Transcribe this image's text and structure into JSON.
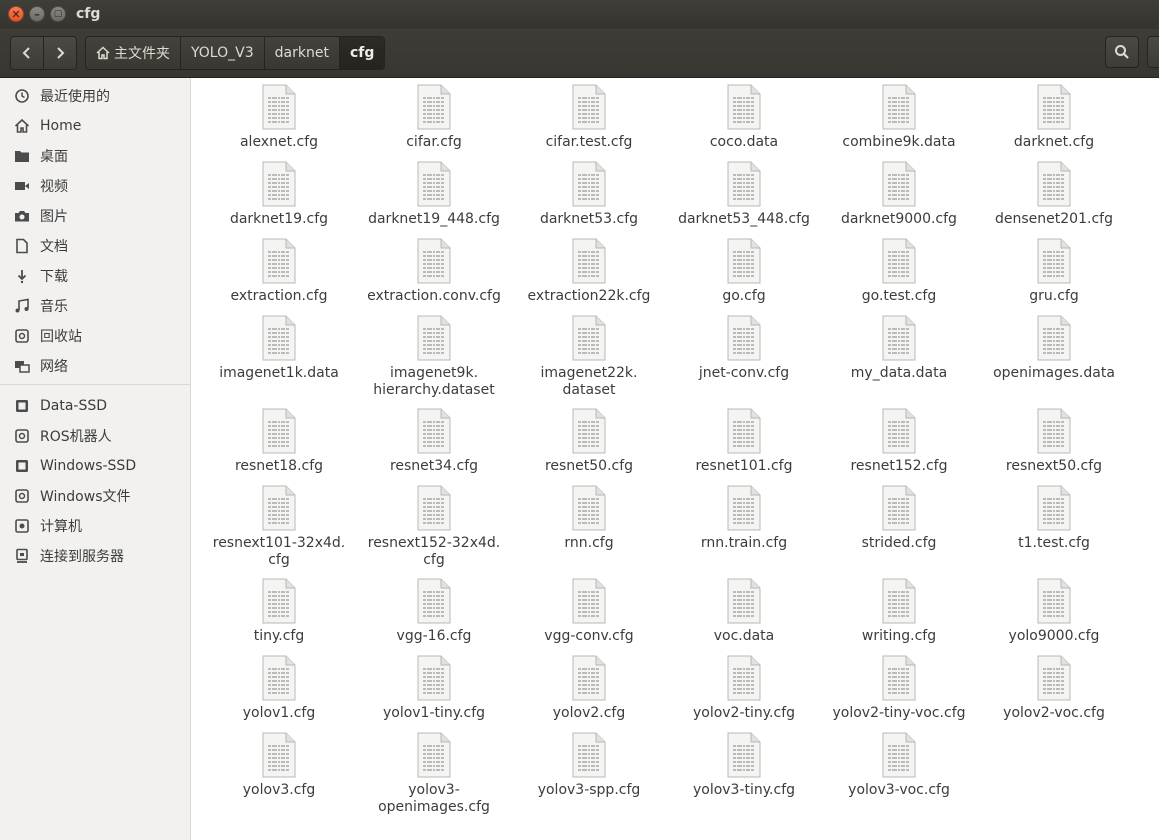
{
  "window": {
    "title": "cfg"
  },
  "toolbar": {
    "back_icon": "chevron-left-icon",
    "forward_icon": "chevron-right-icon",
    "breadcrumb": [
      "主文件夹",
      "YOLO_V3",
      "darknet",
      "cfg"
    ],
    "search_icon": "search-icon"
  },
  "sidebar": {
    "places": [
      {
        "label": "最近使用的",
        "icon": "clock-icon"
      },
      {
        "label": "Home",
        "icon": "home-icon"
      },
      {
        "label": "桌面",
        "icon": "folder-icon"
      },
      {
        "label": "视频",
        "icon": "video-icon"
      },
      {
        "label": "图片",
        "icon": "camera-icon"
      },
      {
        "label": "文档",
        "icon": "document-icon"
      },
      {
        "label": "下载",
        "icon": "download-icon"
      },
      {
        "label": "音乐",
        "icon": "music-icon"
      },
      {
        "label": "回收站",
        "icon": "trash-icon"
      },
      {
        "label": "网络",
        "icon": "network-icon"
      }
    ],
    "devices": [
      {
        "label": "Data-SSD",
        "icon": "drive-icon"
      },
      {
        "label": "ROS机器人",
        "icon": "disc-icon"
      },
      {
        "label": "Windows-SSD",
        "icon": "drive-icon"
      },
      {
        "label": "Windows文件",
        "icon": "disc-icon"
      },
      {
        "label": "计算机",
        "icon": "computer-icon"
      },
      {
        "label": "连接到服务器",
        "icon": "server-icon"
      }
    ]
  },
  "files": [
    "alexnet.cfg",
    "cifar.cfg",
    "cifar.test.cfg",
    "coco.data",
    "combine9k.data",
    "darknet.cfg",
    "darknet19.cfg",
    "darknet19_448.cfg",
    "darknet53.cfg",
    "darknet53_448.cfg",
    "darknet9000.cfg",
    "densenet201.cfg",
    "extraction.cfg",
    "extraction.conv.cfg",
    "extraction22k.cfg",
    "go.cfg",
    "go.test.cfg",
    "gru.cfg",
    "imagenet1k.data",
    "imagenet9k.\nhierarchy.dataset",
    "imagenet22k.\ndataset",
    "jnet-conv.cfg",
    "my_data.data",
    "openimages.data",
    "resnet18.cfg",
    "resnet34.cfg",
    "resnet50.cfg",
    "resnet101.cfg",
    "resnet152.cfg",
    "resnext50.cfg",
    "resnext101-32x4d.\ncfg",
    "resnext152-32x4d.\ncfg",
    "rnn.cfg",
    "rnn.train.cfg",
    "strided.cfg",
    "t1.test.cfg",
    "tiny.cfg",
    "vgg-16.cfg",
    "vgg-conv.cfg",
    "voc.data",
    "writing.cfg",
    "yolo9000.cfg",
    "yolov1.cfg",
    "yolov1-tiny.cfg",
    "yolov2.cfg",
    "yolov2-tiny.cfg",
    "yolov2-tiny-voc.cfg",
    "yolov2-voc.cfg",
    "yolov3.cfg",
    "yolov3-\nopenimages.cfg",
    "yolov3-spp.cfg",
    "yolov3-tiny.cfg",
    "yolov3-voc.cfg"
  ],
  "file_icon": "text-file-icon"
}
